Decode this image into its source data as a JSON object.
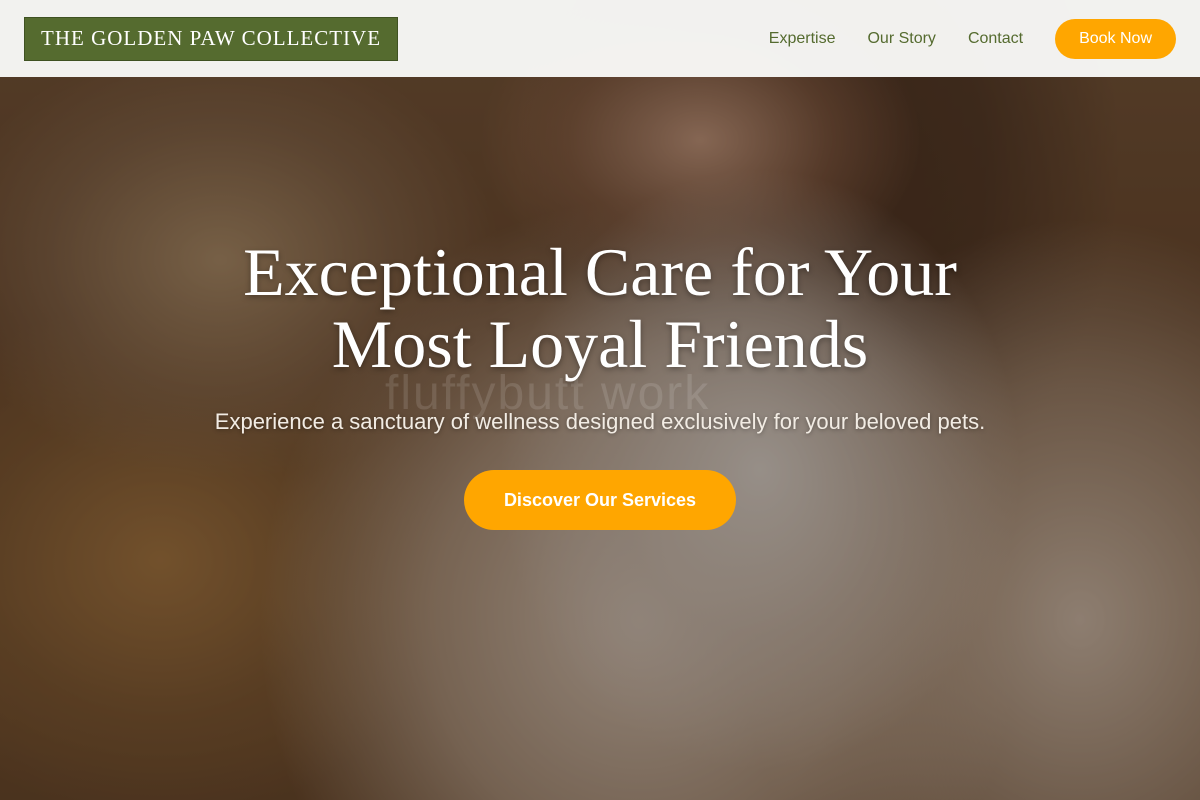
{
  "header": {
    "logo_text": "THE GOLDEN PAW COLLECTIVE",
    "nav": [
      {
        "label": "Expertise"
      },
      {
        "label": "Our Story"
      },
      {
        "label": "Contact"
      }
    ],
    "book_label": "Book Now"
  },
  "hero": {
    "title": "Exceptional Care for Your Most Loyal Friends",
    "subtitle": "Experience a sanctuary of wellness designed exclusively for your beloved pets.",
    "cta_label": "Discover Our Services",
    "photo_credit": "fluffybutt work"
  },
  "colors": {
    "brand_green": "#556b2f",
    "accent_orange": "#ffa600",
    "header_bg": "#f8f8f6"
  }
}
